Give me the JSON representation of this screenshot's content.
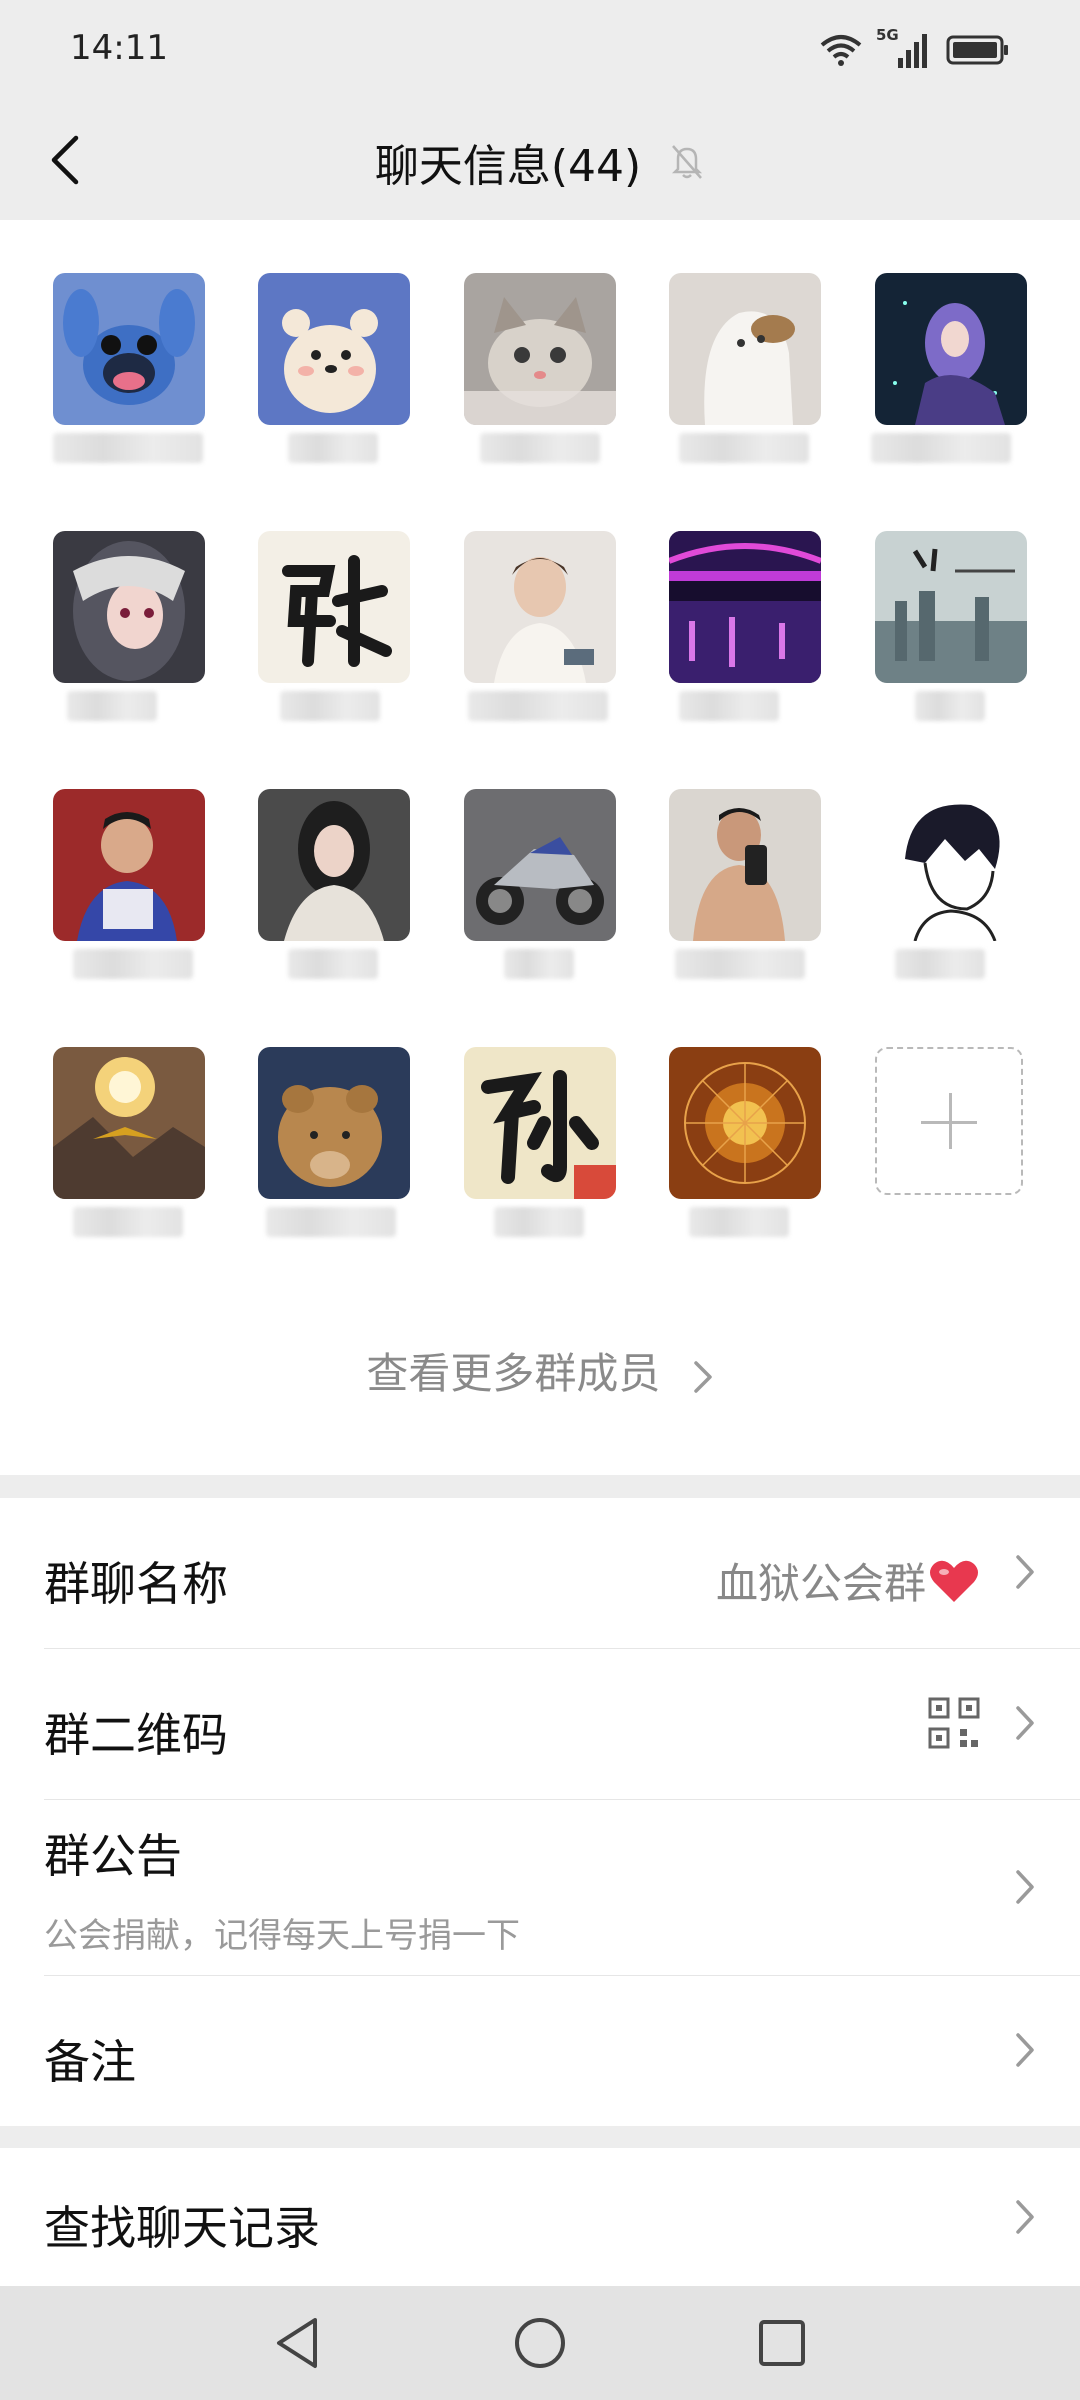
{
  "status_bar": {
    "time": "14:11",
    "network": "5G"
  },
  "header": {
    "title": "聊天信息(44)"
  },
  "members": {
    "avatars": [
      {
        "icon": "stitch-avatar"
      },
      {
        "icon": "bear-avatar"
      },
      {
        "icon": "kitten-avatar"
      },
      {
        "icon": "ghost-dog-avatar"
      },
      {
        "icon": "anime-purple-avatar"
      },
      {
        "icon": "anime-girl-avatar"
      },
      {
        "icon": "zhang-calligraphy-avatar"
      },
      {
        "icon": "boy-photo-avatar"
      },
      {
        "icon": "night-bridge-avatar"
      },
      {
        "icon": "city-text-avatar"
      },
      {
        "icon": "kid-photo-avatar"
      },
      {
        "icon": "woman-photo-avatar"
      },
      {
        "icon": "motorcycle-avatar"
      },
      {
        "icon": "mirror-selfie-avatar"
      },
      {
        "icon": "sketch-boy-avatar"
      },
      {
        "icon": "sunset-eagle-avatar"
      },
      {
        "icon": "lion-cub-avatar"
      },
      {
        "icon": "sun-calligraphy-avatar"
      },
      {
        "icon": "golden-coin-avatar"
      }
    ],
    "more_label": "查看更多群成员"
  },
  "settings": {
    "group_name_label": "群聊名称",
    "group_name_value": "血狱公会群",
    "qr_label": "群二维码",
    "notice_label": "群公告",
    "notice_text": "公会捐献，记得每天上号捐一下",
    "remark_label": "备注",
    "search_label": "查找聊天记录"
  },
  "colors": {
    "background": "#ededed",
    "heart": "#e8384f",
    "secondary_text": "#888888"
  }
}
